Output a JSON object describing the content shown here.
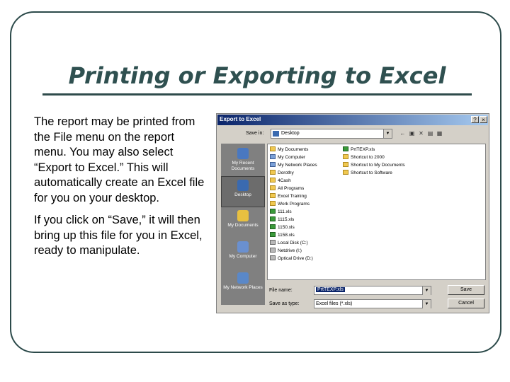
{
  "slide": {
    "title": "Printing or Exporting to Excel",
    "paragraph1": "The report may be printed from the File menu on the report menu.  You may also select “Export to Excel.”  This will automatically create an Excel file for you on your desktop.",
    "paragraph2": "If you click on “Save,” it will then bring up this file for you in Excel, ready to manipulate."
  },
  "dialog": {
    "title": "Export to Excel",
    "help_glyph": "?",
    "close_glyph": "×",
    "save_in_label": "Save in:",
    "save_in_value": "Desktop",
    "places": [
      {
        "label": "My Recent Documents",
        "icon": "recent-documents-icon",
        "color": "#4a78c0"
      },
      {
        "label": "Desktop",
        "icon": "desktop-icon",
        "color": "#3a6ab0"
      },
      {
        "label": "My Documents",
        "icon": "my-documents-icon",
        "color": "#e8c040"
      },
      {
        "label": "My Computer",
        "icon": "my-computer-icon",
        "color": "#6a90d0"
      },
      {
        "label": "My Network Places",
        "icon": "network-places-icon",
        "color": "#5a88c8"
      }
    ],
    "files_col1": [
      {
        "name": "My Documents",
        "icon": "folder"
      },
      {
        "name": "My Computer",
        "icon": "sys"
      },
      {
        "name": "My Network Places",
        "icon": "sys"
      },
      {
        "name": "Dorothy",
        "icon": "folder"
      },
      {
        "name": "4Cash",
        "icon": "folder"
      },
      {
        "name": "All Programs",
        "icon": "folder"
      },
      {
        "name": "Excel Training",
        "icon": "folder"
      },
      {
        "name": "Work Programs",
        "icon": "folder"
      },
      {
        "name": "111.xls",
        "icon": "xls"
      },
      {
        "name": "1115.xls",
        "icon": "xls"
      },
      {
        "name": "1150.xls",
        "icon": "xls"
      },
      {
        "name": "1158.xls",
        "icon": "xls"
      },
      {
        "name": "Local Disk (C:)",
        "icon": "drv"
      },
      {
        "name": "Netdrive (I:)",
        "icon": "drv"
      },
      {
        "name": "Optical Drive (D:)",
        "icon": "drv"
      }
    ],
    "files_col2": [
      {
        "name": "PrtTEXP.xls",
        "icon": "xls"
      },
      {
        "name": "Shortcut to 2000",
        "icon": "folder"
      },
      {
        "name": "Shortcut to My Documents",
        "icon": "folder"
      },
      {
        "name": "Shortcut to Software",
        "icon": "folder"
      }
    ],
    "file_name_label": "File name:",
    "file_name_value": "PrtTEXP.xls",
    "save_as_type_label": "Save as type:",
    "save_as_type_value": "Excel files (*.xls)",
    "save_button": "Save",
    "cancel_button": "Cancel",
    "dropdown_glyph": "▼",
    "toolbar_glyphs": [
      "←",
      "▣",
      "✕",
      "▤",
      "▦"
    ]
  }
}
